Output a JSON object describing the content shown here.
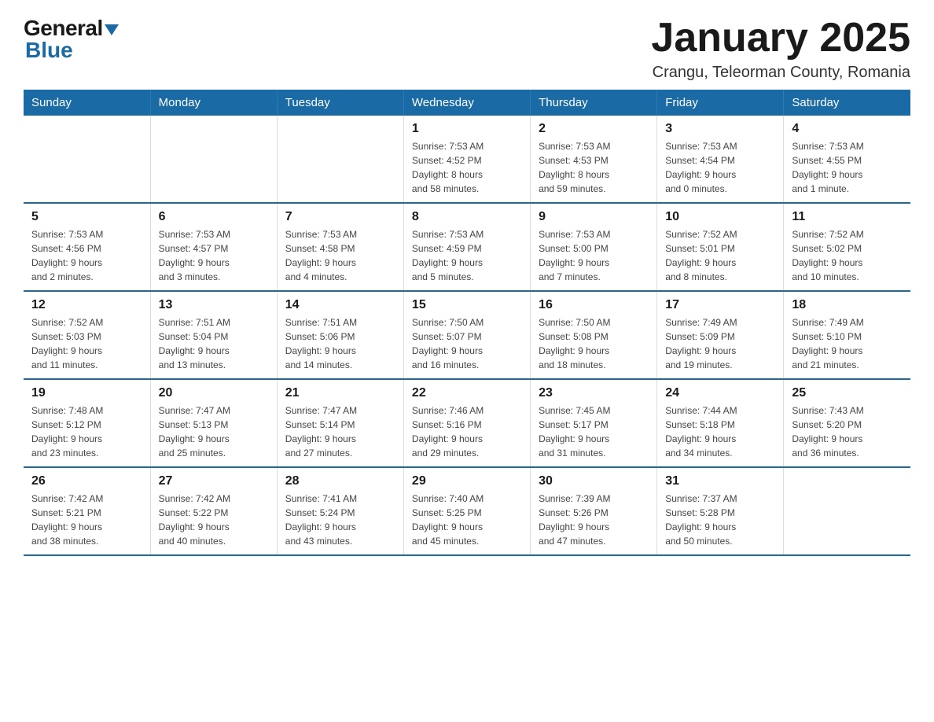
{
  "logo": {
    "general": "General",
    "arrow": "▶",
    "blue": "Blue"
  },
  "title": "January 2025",
  "subtitle": "Crangu, Teleorman County, Romania",
  "weekdays": [
    "Sunday",
    "Monday",
    "Tuesday",
    "Wednesday",
    "Thursday",
    "Friday",
    "Saturday"
  ],
  "weeks": [
    [
      {
        "day": "",
        "info": ""
      },
      {
        "day": "",
        "info": ""
      },
      {
        "day": "",
        "info": ""
      },
      {
        "day": "1",
        "info": "Sunrise: 7:53 AM\nSunset: 4:52 PM\nDaylight: 8 hours\nand 58 minutes."
      },
      {
        "day": "2",
        "info": "Sunrise: 7:53 AM\nSunset: 4:53 PM\nDaylight: 8 hours\nand 59 minutes."
      },
      {
        "day": "3",
        "info": "Sunrise: 7:53 AM\nSunset: 4:54 PM\nDaylight: 9 hours\nand 0 minutes."
      },
      {
        "day": "4",
        "info": "Sunrise: 7:53 AM\nSunset: 4:55 PM\nDaylight: 9 hours\nand 1 minute."
      }
    ],
    [
      {
        "day": "5",
        "info": "Sunrise: 7:53 AM\nSunset: 4:56 PM\nDaylight: 9 hours\nand 2 minutes."
      },
      {
        "day": "6",
        "info": "Sunrise: 7:53 AM\nSunset: 4:57 PM\nDaylight: 9 hours\nand 3 minutes."
      },
      {
        "day": "7",
        "info": "Sunrise: 7:53 AM\nSunset: 4:58 PM\nDaylight: 9 hours\nand 4 minutes."
      },
      {
        "day": "8",
        "info": "Sunrise: 7:53 AM\nSunset: 4:59 PM\nDaylight: 9 hours\nand 5 minutes."
      },
      {
        "day": "9",
        "info": "Sunrise: 7:53 AM\nSunset: 5:00 PM\nDaylight: 9 hours\nand 7 minutes."
      },
      {
        "day": "10",
        "info": "Sunrise: 7:52 AM\nSunset: 5:01 PM\nDaylight: 9 hours\nand 8 minutes."
      },
      {
        "day": "11",
        "info": "Sunrise: 7:52 AM\nSunset: 5:02 PM\nDaylight: 9 hours\nand 10 minutes."
      }
    ],
    [
      {
        "day": "12",
        "info": "Sunrise: 7:52 AM\nSunset: 5:03 PM\nDaylight: 9 hours\nand 11 minutes."
      },
      {
        "day": "13",
        "info": "Sunrise: 7:51 AM\nSunset: 5:04 PM\nDaylight: 9 hours\nand 13 minutes."
      },
      {
        "day": "14",
        "info": "Sunrise: 7:51 AM\nSunset: 5:06 PM\nDaylight: 9 hours\nand 14 minutes."
      },
      {
        "day": "15",
        "info": "Sunrise: 7:50 AM\nSunset: 5:07 PM\nDaylight: 9 hours\nand 16 minutes."
      },
      {
        "day": "16",
        "info": "Sunrise: 7:50 AM\nSunset: 5:08 PM\nDaylight: 9 hours\nand 18 minutes."
      },
      {
        "day": "17",
        "info": "Sunrise: 7:49 AM\nSunset: 5:09 PM\nDaylight: 9 hours\nand 19 minutes."
      },
      {
        "day": "18",
        "info": "Sunrise: 7:49 AM\nSunset: 5:10 PM\nDaylight: 9 hours\nand 21 minutes."
      }
    ],
    [
      {
        "day": "19",
        "info": "Sunrise: 7:48 AM\nSunset: 5:12 PM\nDaylight: 9 hours\nand 23 minutes."
      },
      {
        "day": "20",
        "info": "Sunrise: 7:47 AM\nSunset: 5:13 PM\nDaylight: 9 hours\nand 25 minutes."
      },
      {
        "day": "21",
        "info": "Sunrise: 7:47 AM\nSunset: 5:14 PM\nDaylight: 9 hours\nand 27 minutes."
      },
      {
        "day": "22",
        "info": "Sunrise: 7:46 AM\nSunset: 5:16 PM\nDaylight: 9 hours\nand 29 minutes."
      },
      {
        "day": "23",
        "info": "Sunrise: 7:45 AM\nSunset: 5:17 PM\nDaylight: 9 hours\nand 31 minutes."
      },
      {
        "day": "24",
        "info": "Sunrise: 7:44 AM\nSunset: 5:18 PM\nDaylight: 9 hours\nand 34 minutes."
      },
      {
        "day": "25",
        "info": "Sunrise: 7:43 AM\nSunset: 5:20 PM\nDaylight: 9 hours\nand 36 minutes."
      }
    ],
    [
      {
        "day": "26",
        "info": "Sunrise: 7:42 AM\nSunset: 5:21 PM\nDaylight: 9 hours\nand 38 minutes."
      },
      {
        "day": "27",
        "info": "Sunrise: 7:42 AM\nSunset: 5:22 PM\nDaylight: 9 hours\nand 40 minutes."
      },
      {
        "day": "28",
        "info": "Sunrise: 7:41 AM\nSunset: 5:24 PM\nDaylight: 9 hours\nand 43 minutes."
      },
      {
        "day": "29",
        "info": "Sunrise: 7:40 AM\nSunset: 5:25 PM\nDaylight: 9 hours\nand 45 minutes."
      },
      {
        "day": "30",
        "info": "Sunrise: 7:39 AM\nSunset: 5:26 PM\nDaylight: 9 hours\nand 47 minutes."
      },
      {
        "day": "31",
        "info": "Sunrise: 7:37 AM\nSunset: 5:28 PM\nDaylight: 9 hours\nand 50 minutes."
      },
      {
        "day": "",
        "info": ""
      }
    ]
  ]
}
